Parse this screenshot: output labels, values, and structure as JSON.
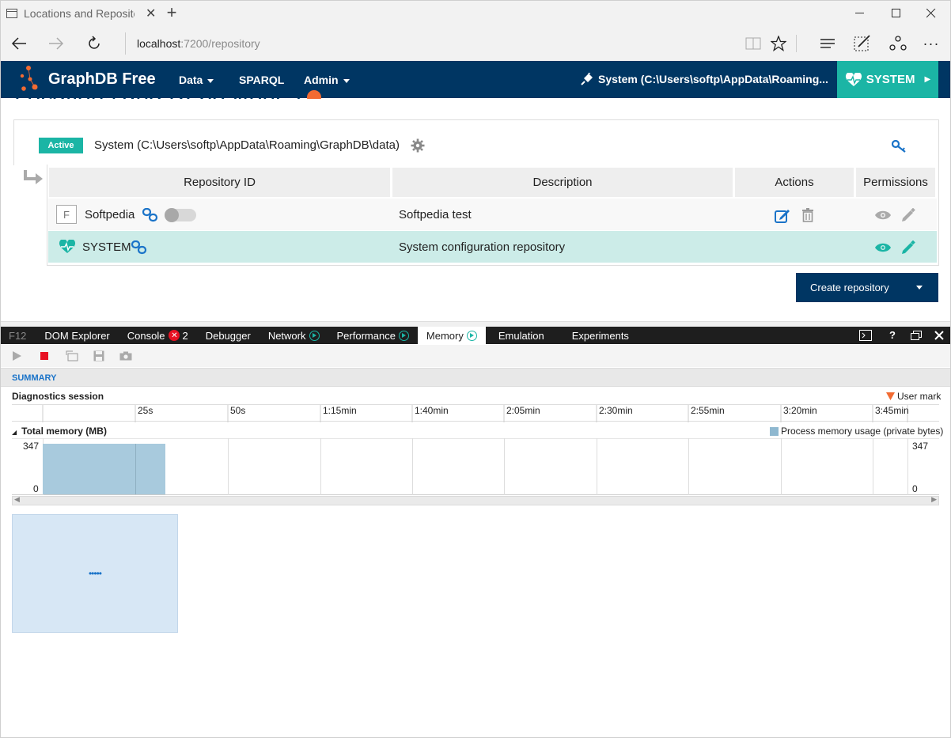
{
  "browser": {
    "tab_title": "Locations and Repositor",
    "address_host": "localhost",
    "address_rest": ":7200/repository"
  },
  "app": {
    "logo_text": "GraphDB Free",
    "menu": {
      "data": "Data",
      "sparql": "SPARQL",
      "admin": "Admin"
    },
    "location_text": "System (C:\\Users\\softp\\AppData\\Roaming...",
    "repo_button": "SYSTEM",
    "brand_color": "#003663",
    "accent_color": "#1bb5a5"
  },
  "page": {
    "title": "Locations and Repositories",
    "location": {
      "badge": "Active",
      "path": "System (C:\\Users\\softp\\AppData\\Roaming\\GraphDB\\data)"
    },
    "table": {
      "headers": [
        "Repository ID",
        "Description",
        "Actions",
        "Permissions"
      ],
      "rows": [
        {
          "type_letter": "F",
          "id": "Softpedia",
          "description": "Softpedia test"
        },
        {
          "id": "SYSTEM",
          "description": "System configuration repository"
        }
      ]
    },
    "create_button": "Create repository"
  },
  "devtools": {
    "f12": "F12",
    "tabs": [
      "DOM Explorer",
      "Console",
      "Debugger",
      "Network",
      "Performance",
      "Memory",
      "Emulation",
      "Experiments"
    ],
    "console_errors": "2",
    "summary": "SUMMARY",
    "diagnostics_session": "Diagnostics session",
    "user_mark": "User mark",
    "ticks": [
      "25s",
      "50s",
      "1:15min",
      "1:40min",
      "2:05min",
      "2:30min",
      "2:55min",
      "3:20min",
      "3:45min"
    ],
    "total_memory": "Total memory (MB)",
    "legend": "Process memory usage (private bytes)",
    "y_max": "347",
    "y_min": "0",
    "loading_dots": "•••••"
  }
}
